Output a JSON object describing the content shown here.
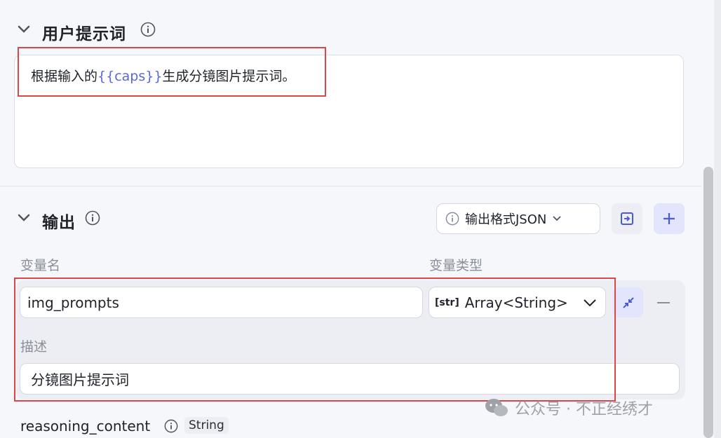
{
  "user_prompt": {
    "title": "用户提示词",
    "text_before": "根据输入的",
    "variable": "{{caps}}",
    "text_after": "生成分镜图片提示词。"
  },
  "output": {
    "title": "输出",
    "format_button": "输出格式JSON",
    "col_name_label": "变量名",
    "col_type_label": "变量类型",
    "variable_name": "img_prompts",
    "type_icon": "[str]",
    "variable_type": "Array<String>",
    "desc_label": "描述",
    "description": "分镜图片提示词",
    "reasoning_name": "reasoning_content",
    "reasoning_type": "String"
  },
  "watermark": "公众号 · 不正经绣才",
  "icons": [
    "chevron-down-icon",
    "info-icon",
    "import-icon",
    "plus-icon",
    "collapse-icon",
    "minus-icon",
    "wechat-icon"
  ],
  "colors": {
    "variable": "#5b67d6",
    "highlight": "#d9474b",
    "accent_bg": "#e2e5fb"
  }
}
